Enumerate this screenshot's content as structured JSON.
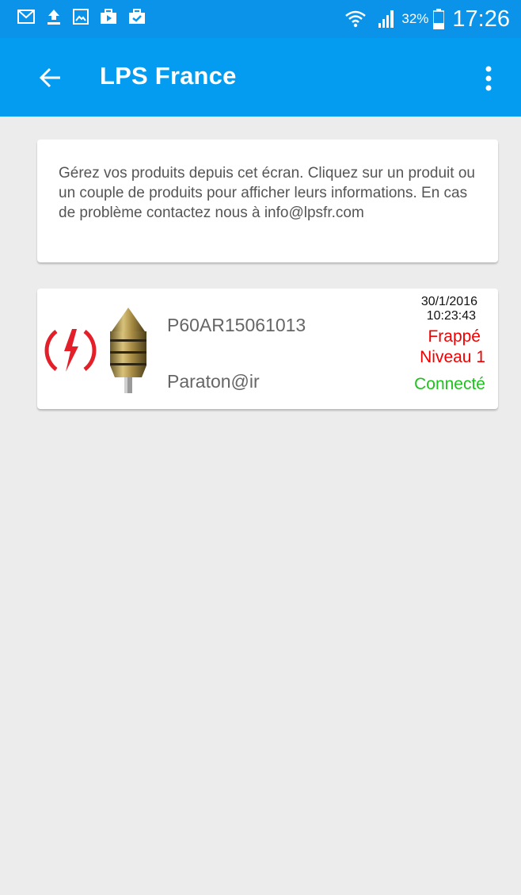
{
  "status_bar": {
    "battery_percent": "32%",
    "time": "17:26",
    "icons_left": [
      "gmail-icon",
      "upload-icon",
      "gallery-icon",
      "briefcase-play-icon",
      "briefcase-check-icon"
    ],
    "icons_right": [
      "wifi-icon",
      "signal-icon",
      "battery-icon"
    ]
  },
  "app_bar": {
    "title": "LPS France",
    "color": "#039cf0"
  },
  "info_card": {
    "text": "Gérez vos produits depuis cet écran. Cliquez sur un produit ou un couple de produits pour afficher leurs informations. En cas de problème contactez nous à info@lpsfr.com"
  },
  "products": [
    {
      "serial": "P60AR15061013",
      "model": "Paraton@ir",
      "date": "30/1/2016",
      "time": "10:23:43",
      "strike_status": "Frappé",
      "level": "Niveau 1",
      "connection": "Connecté",
      "status_color": "#f00000",
      "connection_color": "#20c020",
      "icon": "lightning-strike-icon"
    }
  ]
}
